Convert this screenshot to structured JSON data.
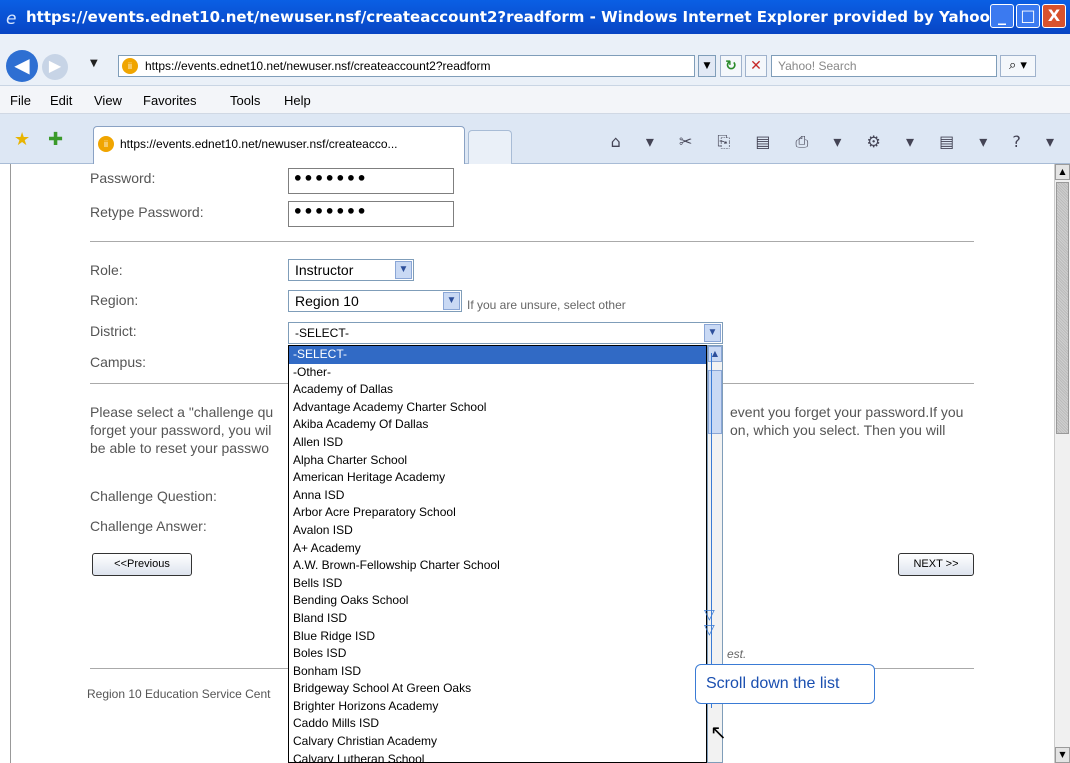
{
  "window": {
    "title": "https://events.ednet10.net/newuser.nsf/createaccount2?readform - Windows Internet Explorer provided by Yahoo!",
    "min": "_",
    "max": "□",
    "close": "X"
  },
  "nav": {
    "back_icon": "◀",
    "forward_icon": "▶",
    "dropdown_icon": "▼",
    "address": "https://events.ednet10.net/newuser.nsf/createaccount2?readform",
    "address_dropdown_icon": "▼",
    "refresh_icon": "↻",
    "stop_icon": "✕",
    "search_placeholder": "Yahoo! Search",
    "search_icon": "⌕ ▾"
  },
  "menu": [
    "File",
    "Edit",
    "View",
    "Favorites",
    "Tools",
    "Help"
  ],
  "tabs": {
    "favorites_icon": "★",
    "add_favorites_icon": "✚",
    "active_label": "https://events.ednet10.net/newuser.nsf/createacco...",
    "toolbar_icons": "⌂ ▾ ✂ ⎘ ▤ ⎙ ▾ ⚙ ▾ ▤ ▾ ? ▾"
  },
  "form": {
    "password_label": "Password:",
    "password_value": "•••••••",
    "retype_label": "Retype Password:",
    "retype_value": "•••••••",
    "role_label": "Role:",
    "role_value": "Instructor",
    "region_label": "Region:",
    "region_value": "Region 10",
    "region_hint": "If you are unsure, select other",
    "district_label": "District:",
    "district_value": "-SELECT-",
    "campus_label": "Campus:",
    "para_line1_left": "Please select a \"challenge qu",
    "para_line1_right": "event you forget your password.If you",
    "para_line2_left": "forget your password, you wil",
    "para_line2_right": "on, which you select. Then you will",
    "para_line3_left": "be able to reset your passwo",
    "challenge_q_label": "Challenge Question:",
    "challenge_a_label": "Challenge Answer:",
    "prev_button": "<<Previous",
    "next_button": "NEXT >>",
    "partial_text": "est.",
    "footer": "Region 10 Education Service Cent"
  },
  "dropdown": {
    "selected_index": 0,
    "options": [
      "-SELECT-",
      "-Other-",
      "Academy of Dallas",
      "Advantage Academy Charter School",
      "Akiba Academy Of Dallas",
      "Allen ISD",
      "Alpha Charter School",
      "American Heritage Academy",
      "Anna ISD",
      "Arbor Acre Preparatory School",
      "Avalon ISD",
      "A+ Academy",
      "A.W. Brown-Fellowship Charter School",
      "Bells ISD",
      "Bending Oaks School",
      "Bland ISD",
      "Blue Ridge ISD",
      "Boles ISD",
      "Bonham ISD",
      "Bridgeway School At Green Oaks",
      "Brighter Horizons Academy",
      "Caddo Mills ISD",
      "Calvary Christian Academy",
      "Calvary Lutheran School"
    ]
  },
  "annotation": {
    "bubble_text": "Scroll down the list",
    "arrow_icon": "▽"
  }
}
